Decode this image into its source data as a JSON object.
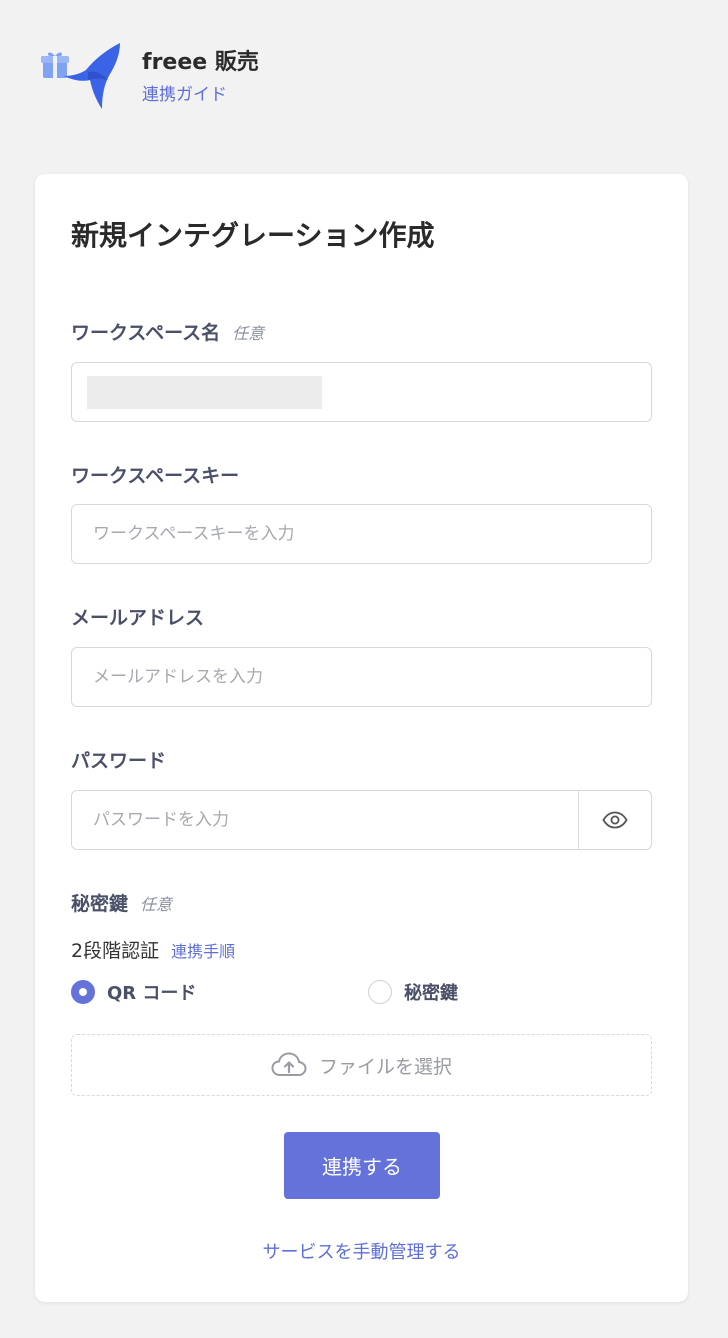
{
  "header": {
    "brand_name": "freee 販売",
    "guide_link": "連携ガイド"
  },
  "form": {
    "title": "新規インテグレーション作成",
    "workspace_name": {
      "label": "ワークスペース名",
      "optional": "任意",
      "value": ""
    },
    "workspace_key": {
      "label": "ワークスペースキー",
      "placeholder": "ワークスペースキーを入力"
    },
    "email": {
      "label": "メールアドレス",
      "placeholder": "メールアドレスを入力"
    },
    "password": {
      "label": "パスワード",
      "placeholder": "パスワードを入力"
    },
    "secret_key": {
      "label": "秘密鍵",
      "optional": "任意"
    },
    "two_factor": {
      "label": "2段階認証",
      "link": "連携手順",
      "options": [
        {
          "label": "QR コード",
          "selected": true
        },
        {
          "label": "秘密鍵",
          "selected": false
        }
      ]
    },
    "file_select": "ファイルを選択",
    "submit": "連携する",
    "manual_link": "サービスを手動管理する"
  },
  "colors": {
    "accent": "#6572d9",
    "link": "#5f6fd9",
    "background": "#f2f2f3",
    "logo_blue": "#3b63e6"
  },
  "icons": [
    "brand-bird-logo",
    "gift-icon",
    "eye-icon",
    "cloud-upload-icon"
  ]
}
